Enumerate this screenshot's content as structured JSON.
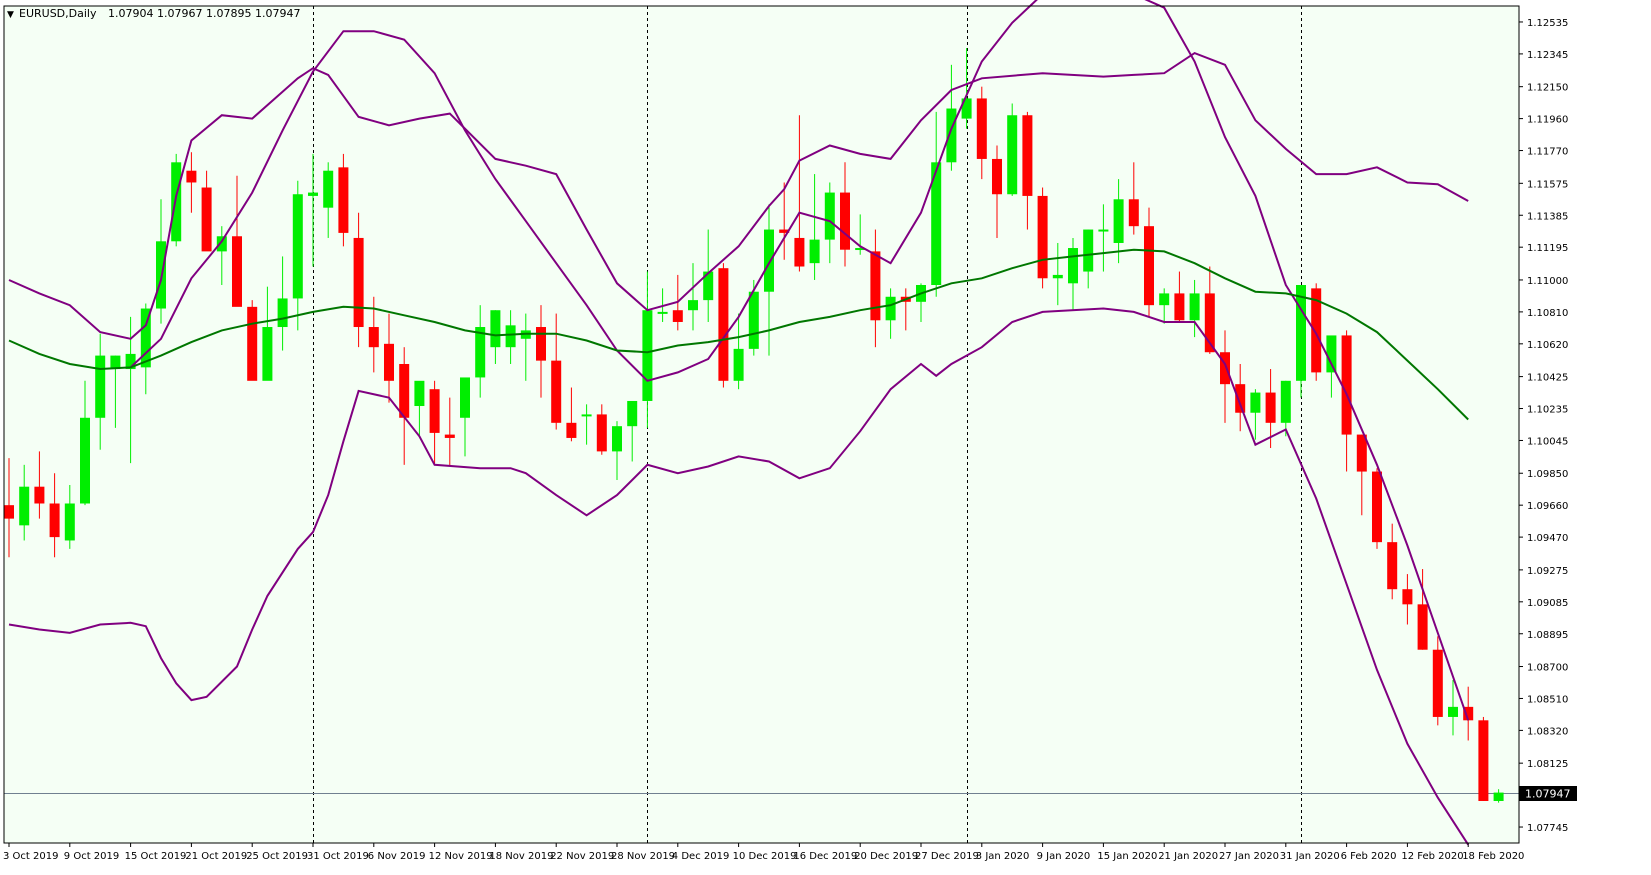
{
  "header": {
    "symbol": "EURUSD,Daily",
    "ohlc": "1.07904 1.07967 1.07895 1.07947"
  },
  "colors": {
    "background": "#f5fff5",
    "bull": "#00ee00",
    "bear": "#ff0000",
    "bollinger": "#800080",
    "moving_average": "#007700",
    "price_line": "#708090"
  },
  "chart_data": {
    "type": "candlestick",
    "symbol": "EURUSD",
    "timeframe": "Daily",
    "ylim": [
      1.0765,
      1.1263
    ],
    "y_ticks": [
      "1.12535",
      "1.12345",
      "1.12150",
      "1.11960",
      "1.11770",
      "1.11575",
      "1.11385",
      "1.11195",
      "1.11000",
      "1.10810",
      "1.10620",
      "1.10425",
      "1.10235",
      "1.10045",
      "1.09850",
      "1.09660",
      "1.09470",
      "1.09275",
      "1.09085",
      "1.08895",
      "1.08700",
      "1.08510",
      "1.08320",
      "1.08125",
      "1.07935",
      "1.07745"
    ],
    "x_ticks": [
      "3 Oct 2019",
      "9 Oct 2019",
      "15 Oct 2019",
      "21 Oct 2019",
      "25 Oct 2019",
      "31 Oct 2019",
      "6 Nov 2019",
      "12 Nov 2019",
      "18 Nov 2019",
      "22 Nov 2019",
      "28 Nov 2019",
      "4 Dec 2019",
      "10 Dec 2019",
      "16 Dec 2019",
      "20 Dec 2019",
      "27 Dec 2019",
      "3 Jan 2020",
      "9 Jan 2020",
      "15 Jan 2020",
      "21 Jan 2020",
      "27 Jan 2020",
      "31 Jan 2020",
      "6 Feb 2020",
      "12 Feb 2020",
      "18 Feb 2020"
    ],
    "x_tick_index": [
      0,
      4,
      8,
      12,
      16,
      20,
      24,
      28,
      32,
      36,
      40,
      44,
      48,
      52,
      56,
      60,
      64,
      68,
      72,
      76,
      80,
      84,
      88,
      92,
      96
    ],
    "separator_index": [
      20,
      42,
      63,
      85
    ],
    "current_price": 1.07947,
    "current_price_label": "1.07947",
    "candles": [
      [
        1.0966,
        1.0994,
        1.0935,
        1.0958
      ],
      [
        1.0954,
        1.099,
        1.0945,
        1.0977
      ],
      [
        1.0977,
        1.0998,
        1.0958,
        1.0967
      ],
      [
        1.0967,
        1.0985,
        1.0935,
        1.0947
      ],
      [
        1.0945,
        1.0978,
        1.094,
        1.0967
      ],
      [
        1.0967,
        1.104,
        1.0966,
        1.1018
      ],
      [
        1.1018,
        1.1068,
        1.0999,
        1.1055
      ],
      [
        1.1047,
        1.1055,
        1.1012,
        1.1055
      ],
      [
        1.1047,
        1.1078,
        1.0991,
        1.1056
      ],
      [
        1.1048,
        1.1086,
        1.1032,
        1.1083
      ],
      [
        1.1083,
        1.1148,
        1.1074,
        1.1123
      ],
      [
        1.1123,
        1.1175,
        1.112,
        1.117
      ],
      [
        1.1165,
        1.1176,
        1.114,
        1.1158
      ],
      [
        1.1155,
        1.1165,
        1.1118,
        1.1117
      ],
      [
        1.1117,
        1.1132,
        1.1097,
        1.1126
      ],
      [
        1.1126,
        1.1162,
        1.109,
        1.1084
      ],
      [
        1.1084,
        1.1088,
        1.107,
        1.104
      ],
      [
        1.104,
        1.1096,
        1.1062,
        1.1072
      ],
      [
        1.1072,
        1.1114,
        1.1058,
        1.1089
      ],
      [
        1.1089,
        1.1159,
        1.107,
        1.1151
      ],
      [
        1.115,
        1.1175,
        1.1108,
        1.1152
      ],
      [
        1.1143,
        1.117,
        1.1125,
        1.1165
      ],
      [
        1.1167,
        1.1175,
        1.112,
        1.1128
      ],
      [
        1.1125,
        1.114,
        1.106,
        1.1072
      ],
      [
        1.1072,
        1.109,
        1.1045,
        1.106
      ],
      [
        1.1062,
        1.108,
        1.1027,
        1.104
      ],
      [
        1.105,
        1.106,
        1.099,
        1.1018
      ],
      [
        1.1025,
        1.103,
        1.1007,
        1.104
      ],
      [
        1.1035,
        1.104,
        1.099,
        1.1009
      ],
      [
        1.1008,
        1.103,
        1.0989,
        1.1006
      ],
      [
        1.1018,
        1.104,
        1.0995,
        1.1042
      ],
      [
        1.1042,
        1.1085,
        1.103,
        1.1072
      ],
      [
        1.106,
        1.1082,
        1.105,
        1.1082
      ],
      [
        1.106,
        1.1082,
        1.105,
        1.1073
      ],
      [
        1.1065,
        1.108,
        1.104,
        1.107
      ],
      [
        1.1072,
        1.1085,
        1.103,
        1.1052
      ],
      [
        1.1052,
        1.108,
        1.1011,
        1.1015
      ],
      [
        1.1015,
        1.1036,
        1.1004,
        1.1006
      ],
      [
        1.102,
        1.1026,
        1.1002,
        1.102
      ],
      [
        1.102,
        1.1026,
        1.0996,
        1.0998
      ],
      [
        1.0998,
        1.1016,
        1.0981,
        1.1013
      ],
      [
        1.1013,
        1.1025,
        1.0992,
        1.1028
      ],
      [
        1.1028,
        1.1105,
        1.1012,
        1.1082
      ],
      [
        1.108,
        1.1095,
        1.1075,
        1.1081
      ],
      [
        1.1082,
        1.1103,
        1.107,
        1.1075
      ],
      [
        1.1082,
        1.111,
        1.107,
        1.1088
      ],
      [
        1.1088,
        1.113,
        1.1075,
        1.1105
      ],
      [
        1.1107,
        1.111,
        1.1036,
        1.104
      ],
      [
        1.104,
        1.108,
        1.1035,
        1.1059
      ],
      [
        1.1059,
        1.11,
        1.1055,
        1.1093
      ],
      [
        1.1093,
        1.1145,
        1.1055,
        1.113
      ],
      [
        1.113,
        1.1158,
        1.1112,
        1.1128
      ],
      [
        1.1125,
        1.1198,
        1.1105,
        1.1108
      ],
      [
        1.111,
        1.1163,
        1.11,
        1.1124
      ],
      [
        1.1124,
        1.1158,
        1.111,
        1.1152
      ],
      [
        1.1152,
        1.117,
        1.1108,
        1.1118
      ],
      [
        1.1118,
        1.1139,
        1.1115,
        1.1119
      ],
      [
        1.1117,
        1.113,
        1.106,
        1.1076
      ],
      [
        1.1076,
        1.1095,
        1.1065,
        1.109
      ],
      [
        1.109,
        1.1095,
        1.107,
        1.1087
      ],
      [
        1.1087,
        1.1098,
        1.1075,
        1.1097
      ],
      [
        1.1097,
        1.12,
        1.109,
        1.117
      ],
      [
        1.117,
        1.1228,
        1.1165,
        1.1202
      ],
      [
        1.1196,
        1.1238,
        1.119,
        1.1208
      ],
      [
        1.1208,
        1.1215,
        1.116,
        1.1172
      ],
      [
        1.1172,
        1.118,
        1.1125,
        1.1151
      ],
      [
        1.1151,
        1.1205,
        1.115,
        1.1198
      ],
      [
        1.1198,
        1.12,
        1.113,
        1.115
      ],
      [
        1.115,
        1.1155,
        1.1095,
        1.1101
      ],
      [
        1.1101,
        1.1122,
        1.1085,
        1.1103
      ],
      [
        1.1098,
        1.1125,
        1.1082,
        1.1119
      ],
      [
        1.1105,
        1.113,
        1.1095,
        1.113
      ],
      [
        1.113,
        1.1145,
        1.1105,
        1.113
      ],
      [
        1.1122,
        1.116,
        1.111,
        1.1148
      ],
      [
        1.1148,
        1.117,
        1.1127,
        1.1132
      ],
      [
        1.1132,
        1.1143,
        1.1078,
        1.1085
      ],
      [
        1.1085,
        1.1095,
        1.1074,
        1.1092
      ],
      [
        1.1092,
        1.1105,
        1.1075,
        1.1076
      ],
      [
        1.1076,
        1.11,
        1.1066,
        1.1092
      ],
      [
        1.1092,
        1.1108,
        1.1056,
        1.1057
      ],
      [
        1.1057,
        1.107,
        1.1015,
        1.1038
      ],
      [
        1.1038,
        1.105,
        1.101,
        1.1021
      ],
      [
        1.1021,
        1.1035,
        1.1005,
        1.1033
      ],
      [
        1.1033,
        1.1047,
        1.1,
        1.1015
      ],
      [
        1.1015,
        1.104,
        1.1007,
        1.104
      ],
      [
        1.104,
        1.1095,
        1.103,
        1.1097
      ],
      [
        1.1095,
        1.1098,
        1.104,
        1.1045
      ],
      [
        1.1045,
        1.1055,
        1.103,
        1.1067
      ],
      [
        1.1067,
        1.107,
        1.0986,
        1.1008
      ],
      [
        1.1008,
        1.1008,
        1.096,
        1.0986
      ],
      [
        1.0986,
        1.0988,
        1.094,
        1.0944
      ],
      [
        1.0944,
        1.0955,
        1.091,
        1.0916
      ],
      [
        1.0916,
        1.0925,
        1.0895,
        1.0907
      ],
      [
        1.0907,
        1.0928,
        1.088,
        1.088
      ],
      [
        1.088,
        1.0888,
        1.0835,
        1.084
      ],
      [
        1.084,
        1.0862,
        1.0829,
        1.0846
      ],
      [
        1.0846,
        1.0858,
        1.0826,
        1.0838
      ],
      [
        1.0838,
        1.084,
        1.079,
        1.079
      ],
      [
        1.079,
        1.0797,
        1.0789,
        1.0795
      ]
    ],
    "bollinger_upper": [
      [
        0,
        1.11
      ],
      [
        2,
        1.1092
      ],
      [
        4,
        1.1085
      ],
      [
        6,
        1.1069
      ],
      [
        8,
        1.1065
      ],
      [
        9,
        1.1073
      ],
      [
        10,
        1.11
      ],
      [
        11,
        1.115
      ],
      [
        12,
        1.1183
      ],
      [
        14,
        1.1198
      ],
      [
        16,
        1.1196
      ],
      [
        19,
        1.122
      ],
      [
        20,
        1.1226
      ],
      [
        21,
        1.1222
      ],
      [
        23,
        1.1197
      ],
      [
        25,
        1.1192
      ],
      [
        27,
        1.1196
      ],
      [
        29,
        1.1199
      ],
      [
        32,
        1.1172
      ],
      [
        34,
        1.1168
      ],
      [
        36,
        1.1163
      ],
      [
        38,
        1.113
      ],
      [
        40,
        1.1098
      ],
      [
        42,
        1.1082
      ],
      [
        44,
        1.1087
      ],
      [
        46,
        1.1104
      ],
      [
        48,
        1.112
      ],
      [
        50,
        1.1144
      ],
      [
        51,
        1.1154
      ],
      [
        52,
        1.1171
      ],
      [
        54,
        1.118
      ],
      [
        56,
        1.1175
      ],
      [
        58,
        1.1172
      ],
      [
        60,
        1.1195
      ],
      [
        62,
        1.1213
      ],
      [
        64,
        1.122
      ],
      [
        68,
        1.1223
      ],
      [
        72,
        1.1221
      ],
      [
        74,
        1.1222
      ],
      [
        76,
        1.1223
      ],
      [
        78,
        1.1235
      ],
      [
        80,
        1.1228
      ],
      [
        82,
        1.1195
      ],
      [
        84,
        1.1178
      ],
      [
        86,
        1.1163
      ],
      [
        88,
        1.1163
      ],
      [
        90,
        1.1167
      ],
      [
        92,
        1.1158
      ],
      [
        94,
        1.1157
      ],
      [
        96,
        1.1147
      ]
    ],
    "bollinger_middle": [
      [
        0,
        1.1064
      ],
      [
        2,
        1.1056
      ],
      [
        4,
        1.105
      ],
      [
        6,
        1.1047
      ],
      [
        8,
        1.1048
      ],
      [
        10,
        1.1055
      ],
      [
        12,
        1.1063
      ],
      [
        14,
        1.107
      ],
      [
        16,
        1.1074
      ],
      [
        18,
        1.1077
      ],
      [
        20,
        1.1081
      ],
      [
        22,
        1.1084
      ],
      [
        24,
        1.1083
      ],
      [
        26,
        1.1079
      ],
      [
        28,
        1.1075
      ],
      [
        30,
        1.107
      ],
      [
        32,
        1.1067
      ],
      [
        34,
        1.1068
      ],
      [
        36,
        1.1068
      ],
      [
        38,
        1.1064
      ],
      [
        40,
        1.1058
      ],
      [
        42,
        1.1057
      ],
      [
        44,
        1.1061
      ],
      [
        46,
        1.1063
      ],
      [
        48,
        1.1066
      ],
      [
        50,
        1.107
      ],
      [
        52,
        1.1075
      ],
      [
        54,
        1.1078
      ],
      [
        56,
        1.1082
      ],
      [
        58,
        1.1085
      ],
      [
        60,
        1.1092
      ],
      [
        62,
        1.1098
      ],
      [
        64,
        1.1101
      ],
      [
        66,
        1.1107
      ],
      [
        68,
        1.1112
      ],
      [
        70,
        1.1114
      ],
      [
        72,
        1.1116
      ],
      [
        74,
        1.1118
      ],
      [
        76,
        1.1117
      ],
      [
        78,
        1.111
      ],
      [
        80,
        1.1101
      ],
      [
        82,
        1.1093
      ],
      [
        84,
        1.1092
      ],
      [
        86,
        1.1088
      ],
      [
        88,
        1.108
      ],
      [
        90,
        1.1069
      ],
      [
        92,
        1.1052
      ],
      [
        94,
        1.1035
      ],
      [
        96,
        1.1017
      ]
    ],
    "bollinger_lower": [
      [
        0,
        1.0895
      ],
      [
        2,
        1.0892
      ],
      [
        4,
        1.089
      ],
      [
        6,
        1.0895
      ],
      [
        8,
        1.0896
      ],
      [
        9,
        1.0894
      ],
      [
        10,
        1.0875
      ],
      [
        11,
        1.086
      ],
      [
        12,
        1.085
      ],
      [
        13,
        1.0852
      ],
      [
        15,
        1.087
      ],
      [
        16,
        1.0892
      ],
      [
        17,
        1.0912
      ],
      [
        19,
        1.094
      ],
      [
        20,
        1.095
      ],
      [
        21,
        1.0972
      ],
      [
        22,
        1.1004
      ],
      [
        23,
        1.1034
      ],
      [
        25,
        1.103
      ],
      [
        27,
        1.1007
      ],
      [
        28,
        1.099
      ],
      [
        31,
        1.0988
      ],
      [
        33,
        1.0988
      ],
      [
        34,
        1.0985
      ],
      [
        36,
        1.0972
      ],
      [
        38,
        1.096
      ],
      [
        40,
        1.0972
      ],
      [
        42,
        1.099
      ],
      [
        44,
        1.0985
      ],
      [
        46,
        1.0989
      ],
      [
        48,
        1.0995
      ],
      [
        50,
        1.0992
      ],
      [
        52,
        1.0982
      ],
      [
        54,
        1.0988
      ],
      [
        56,
        1.101
      ],
      [
        58,
        1.1035
      ],
      [
        60,
        1.105
      ],
      [
        61,
        1.1043
      ],
      [
        62,
        1.105
      ],
      [
        64,
        1.106
      ],
      [
        66,
        1.1075
      ],
      [
        68,
        1.1081
      ],
      [
        72,
        1.1083
      ],
      [
        74,
        1.1081
      ],
      [
        76,
        1.1075
      ],
      [
        78,
        1.1075
      ],
      [
        80,
        1.105
      ],
      [
        82,
        1.1002
      ],
      [
        84,
        1.1011
      ],
      [
        86,
        1.097
      ],
      [
        88,
        1.0919
      ],
      [
        90,
        1.0868
      ],
      [
        92,
        1.0824
      ],
      [
        94,
        1.0792
      ],
      [
        96,
        1.0764
      ]
    ],
    "ma_blue": [
      [
        8,
        1.1048
      ],
      [
        10,
        1.1065
      ],
      [
        12,
        1.1101
      ],
      [
        14,
        1.1123
      ],
      [
        16,
        1.1152
      ],
      [
        18,
        1.1189
      ],
      [
        20,
        1.1224
      ],
      [
        22,
        1.1248
      ],
      [
        24,
        1.1248
      ],
      [
        26,
        1.1243
      ],
      [
        28,
        1.1223
      ],
      [
        30,
        1.1189
      ],
      [
        32,
        1.116
      ],
      [
        34,
        1.1135
      ],
      [
        36,
        1.111
      ],
      [
        38,
        1.1085
      ],
      [
        40,
        1.1058
      ],
      [
        42,
        1.104
      ],
      [
        44,
        1.1045
      ],
      [
        46,
        1.1053
      ],
      [
        48,
        1.1078
      ],
      [
        50,
        1.111
      ],
      [
        52,
        1.114
      ],
      [
        54,
        1.1135
      ],
      [
        56,
        1.112
      ],
      [
        58,
        1.111
      ],
      [
        60,
        1.114
      ],
      [
        62,
        1.119
      ],
      [
        64,
        1.123
      ],
      [
        66,
        1.1253
      ],
      [
        68,
        1.127
      ],
      [
        70,
        1.1272
      ],
      [
        72,
        1.1272
      ],
      [
        74,
        1.127
      ],
      [
        76,
        1.1262
      ],
      [
        78,
        1.123
      ],
      [
        80,
        1.1185
      ],
      [
        82,
        1.115
      ],
      [
        84,
        1.1097
      ],
      [
        86,
        1.1068
      ],
      [
        88,
        1.1032
      ],
      [
        90,
        1.099
      ],
      [
        92,
        1.0942
      ],
      [
        94,
        1.089
      ],
      [
        96,
        1.0838
      ]
    ]
  }
}
